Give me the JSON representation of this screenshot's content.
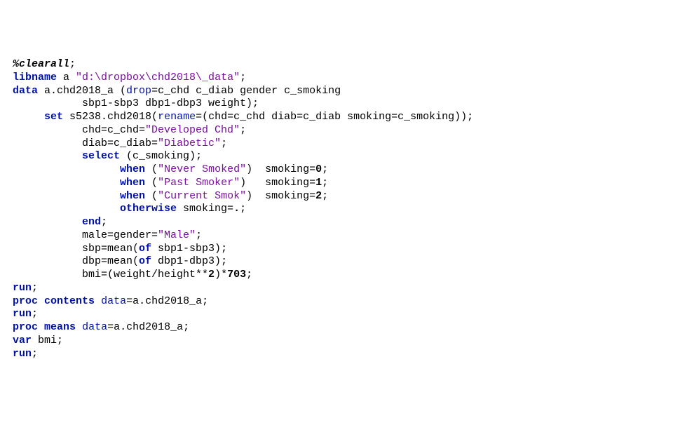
{
  "code": {
    "l1": {
      "macro": "%clearall",
      "semi": ";"
    },
    "l2": {
      "kw": "libname",
      "t1": " a ",
      "str": "\"d:\\dropbox\\chd2018\\_data\"",
      "semi": ";"
    },
    "l3": {
      "kw": "data",
      "t1": " a.chd2018_a (",
      "opt1": "drop",
      "t2": "=c_chd c_diab gender c_smoking"
    },
    "l4": {
      "t1": "           sbp1-sbp3 dbp1-dbp3 weight);"
    },
    "l5": {
      "t0": "     ",
      "kw": "set",
      "t1": " s5238.chd2018(",
      "opt1": "rename",
      "t2": "=(chd=c_chd diab=c_diab smoking=c_smoking));"
    },
    "l6": {
      "t1": "           chd=c_chd=",
      "str": "\"Developed Chd\"",
      "semi": ";"
    },
    "l7": {
      "t1": "           diab=c_diab=",
      "str": "\"Diabetic\"",
      "semi": ";"
    },
    "l8": {
      "t1": "           ",
      "kw": "select",
      "t2": " (c_smoking);"
    },
    "l9": {
      "t1": "                 ",
      "kw": "when",
      "t2": " (",
      "str": "\"Never Smoked\"",
      "t3": ")  smoking=",
      "num": "0",
      "semi": ";"
    },
    "l10": {
      "t1": "                 ",
      "kw": "when",
      "t2": " (",
      "str": "\"Past Smoker\"",
      "t3": ")   smoking=",
      "num": "1",
      "semi": ";"
    },
    "l11": {
      "t1": "                 ",
      "kw": "when",
      "t2": " (",
      "str": "\"Current Smok\"",
      "t3": ")  smoking=",
      "num": "2",
      "semi": ";"
    },
    "l12": {
      "t1": "                 ",
      "kw": "otherwise",
      "t2": " smoking=",
      "num": ".",
      "semi": ";"
    },
    "l13": {
      "t1": "           ",
      "kw": "end",
      "semi": ";"
    },
    "l14": {
      "t1": "           male=gender=",
      "str": "\"Male\"",
      "semi": ";"
    },
    "l15": {
      "t1": "           sbp=mean(",
      "kw": "of",
      "t2": " sbp1-sbp3);"
    },
    "l16": {
      "t1": "           dbp=mean(",
      "kw": "of",
      "t2": " dbp1-dbp3);"
    },
    "l17": {
      "t1": "           bmi=(weight/height**",
      "num1": "2",
      "t2": ")*",
      "num2": "703",
      "semi": ";"
    },
    "l18": {
      "kw": "run",
      "semi": ";"
    },
    "l19": {
      "kw1": "proc",
      "t1": " ",
      "kw2": "contents",
      "t2": " ",
      "opt": "data",
      "t3": "=a.chd2018_a;"
    },
    "l20": {
      "kw": "run",
      "semi": ";"
    },
    "l21": {
      "kw1": "proc",
      "t1": " ",
      "kw2": "means",
      "t2": " ",
      "opt": "data",
      "t3": "=a.chd2018_a;"
    },
    "l22": {
      "kw": "var",
      "t1": " bmi;"
    },
    "l23": {
      "kw": "run",
      "semi": ";"
    }
  }
}
